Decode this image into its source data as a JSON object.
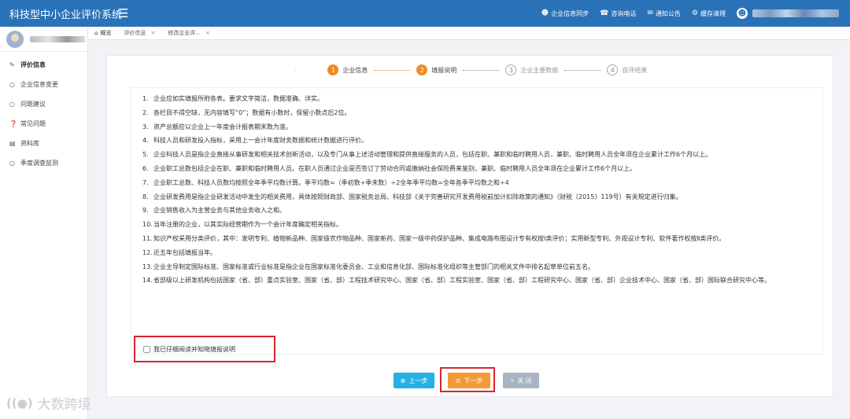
{
  "app": {
    "title": "科技型中小企业评价系统",
    "menu_icon": "hamburger-icon"
  },
  "header": {
    "actions": [
      {
        "icon": "user-icon",
        "label": "企业信息同步"
      },
      {
        "icon": "phone-icon",
        "label": "咨询电话"
      },
      {
        "icon": "mail-icon",
        "label": "通知公告"
      },
      {
        "icon": "gear-icon",
        "label": "缓存清理"
      }
    ]
  },
  "sidebar": {
    "items": [
      {
        "icon": "edit-icon",
        "label": "评价信息"
      },
      {
        "icon": "circle-icon",
        "label": "企业信息变更"
      },
      {
        "icon": "comment-icon",
        "label": "问题建议"
      },
      {
        "icon": "question-icon",
        "label": "常见问题"
      },
      {
        "icon": "folder-icon",
        "label": "资料库"
      },
      {
        "icon": "circle-icon",
        "label": "季度调查监测"
      }
    ]
  },
  "tabs": [
    {
      "label": "概览",
      "closable": false
    },
    {
      "label": "评价信息",
      "closable": true
    },
    {
      "label": "修改企业评...",
      "closable": true
    }
  ],
  "steps": {
    "lead": "·",
    "items": [
      {
        "num": "1",
        "label": "企业信息"
      },
      {
        "num": "2",
        "label": "填报说明"
      },
      {
        "num": "3",
        "label": "企业主要数据"
      },
      {
        "num": "4",
        "label": "自评结果"
      }
    ]
  },
  "notes": [
    {
      "num": "1.",
      "text": "企业应如实填报所附各表。要求文字简洁，数据准确、详实。"
    },
    {
      "num": "2.",
      "text": "各栏目不得空缺，无内容填写“0”；数据有小数时，保留小数点后2位。"
    },
    {
      "num": "3.",
      "text": "资产总额应以企业上一年度会计报表期末数为准。"
    },
    {
      "num": "4.",
      "text": "科技人员和研发投入指标，采用上一会计年度财务数据和统计数据进行评价。"
    },
    {
      "num": "5.",
      "text": "企业科技人员是指企业直接从事研发和相关技术创新活动，以及专门从事上述活动管理和提供直接服务的人员，包括在职、兼职和临时聘用人员，兼职、临时聘用人员全年须在企业累计工作6个月以上。"
    },
    {
      "num": "6.",
      "text": "企业职工总数包括企业在职、兼职和临时聘用人员。在职人员通过企业是否签订了劳动合同或缴纳社会保险费来鉴别，兼职、临时聘用人员全年须在企业累计工作6个月以上。"
    },
    {
      "num": "7.",
      "text": "企业职工总数、科技人员数均按照全年季平均数计算。季平均数=（季初数+季末数）÷2全年季平均数=全年各季平均数之和÷4"
    },
    {
      "num": "8.",
      "text": "企业研发费用是指企业研发活动中发生的相关费用，具体按照财政部、国家税务总局、科技部《关于完善研究开发费用税前加计扣除政策的通知》（财税〔2015〕119号）有关规定进行归集。"
    },
    {
      "num": "9.",
      "text": "企业销售收入为主营业务与其他业务收入之和。"
    },
    {
      "num": "10.",
      "text": "当年注册的企业，以其实际经营期作为一个会计年度确定相关指标。"
    },
    {
      "num": "11.",
      "text": "知识产权采用分类评价，其中：发明专利、植物新品种、国家级农作物品种、国家新药、国家一级中药保护品种、集成电路布图设计专有权按Ⅰ类评价；实用新型专利、外观设计专利、软件著作权按Ⅱ类评价。"
    },
    {
      "num": "12.",
      "text": "近五年包括填报当年。"
    },
    {
      "num": "13.",
      "text": "企业主导制定国际标准、国家标准或行业标准是指企业在国家标准化委员会、工业和信息化部、国际标准化组织等主管部门的相关文件中排名起草单位前五名。"
    },
    {
      "num": "14.",
      "text": "省部级以上研发机构包括国家（省、部）重点实验室、国家（省、部）工程技术研究中心、国家（省、部）工程实验室、国家（省、部）工程研究中心、国家（省、部）企业技术中心、国家（省、部）国际联合研究中心等。"
    }
  ],
  "confirm": {
    "label": "我已仔细阅读并知晓填报说明",
    "checked": false
  },
  "buttons": {
    "prev": "上一步",
    "next": "下一步",
    "close": "关 闭"
  },
  "watermark": {
    "text": "大数跨境"
  },
  "colors": {
    "header": "#2a72b8",
    "step_active": "#f08a24",
    "prev": "#26b0e6",
    "next": "#f39a36",
    "close": "#a8b4c1",
    "highlight": "#d9232d"
  }
}
